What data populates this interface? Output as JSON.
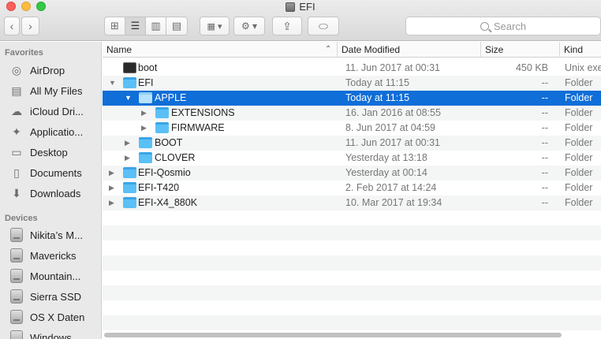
{
  "window": {
    "title": "EFI"
  },
  "toolbar": {
    "view_icons": [
      "icon-view-icon",
      "list-view-icon",
      "column-view-icon",
      "cover-flow-icon"
    ],
    "search_placeholder": "Search"
  },
  "sidebar": {
    "favorites_header": "Favorites",
    "favorites": [
      {
        "label": "AirDrop",
        "icon": "airdrop-icon"
      },
      {
        "label": "All My Files",
        "icon": "all-files-icon"
      },
      {
        "label": "iCloud Dri...",
        "icon": "icloud-icon"
      },
      {
        "label": "Applicatio...",
        "icon": "applications-icon"
      },
      {
        "label": "Desktop",
        "icon": "desktop-icon"
      },
      {
        "label": "Documents",
        "icon": "documents-icon"
      },
      {
        "label": "Downloads",
        "icon": "downloads-icon"
      }
    ],
    "devices_header": "Devices",
    "devices": [
      {
        "label": "Nikita’s M...",
        "icon": "computer-icon"
      },
      {
        "label": "Mavericks",
        "icon": "disk-icon"
      },
      {
        "label": "Mountain...",
        "icon": "disk-icon"
      },
      {
        "label": "Sierra SSD",
        "icon": "disk-icon"
      },
      {
        "label": "OS X Daten",
        "icon": "disk-icon"
      },
      {
        "label": "Windows",
        "icon": "disk-icon"
      }
    ]
  },
  "columns": {
    "name": "Name",
    "date": "Date Modified",
    "size": "Size",
    "kind": "Kind"
  },
  "files": [
    {
      "name": "boot",
      "date": "11. Jun 2017 at 00:31",
      "size": "450 KB",
      "kind": "Unix exe",
      "type": "exec",
      "level": 0,
      "expander": ""
    },
    {
      "name": "EFI",
      "date": "Today at 11:15",
      "size": "--",
      "kind": "Folder",
      "type": "folder",
      "level": 0,
      "expander": "▼"
    },
    {
      "name": "APPLE",
      "date": "Today at 11:15",
      "size": "--",
      "kind": "Folder",
      "type": "folder",
      "level": 1,
      "expander": "▼",
      "selected": true
    },
    {
      "name": "EXTENSIONS",
      "date": "16. Jan 2016 at 08:55",
      "size": "--",
      "kind": "Folder",
      "type": "folder",
      "level": 2,
      "expander": "▶"
    },
    {
      "name": "FIRMWARE",
      "date": "8. Jun 2017 at 04:59",
      "size": "--",
      "kind": "Folder",
      "type": "folder",
      "level": 2,
      "expander": "▶"
    },
    {
      "name": "BOOT",
      "date": "11. Jun 2017 at 00:31",
      "size": "--",
      "kind": "Folder",
      "type": "folder",
      "level": 1,
      "expander": "▶"
    },
    {
      "name": "CLOVER",
      "date": "Yesterday at 13:18",
      "size": "--",
      "kind": "Folder",
      "type": "folder",
      "level": 1,
      "expander": "▶"
    },
    {
      "name": "EFI-Qosmio",
      "date": "Yesterday at 00:14",
      "size": "--",
      "kind": "Folder",
      "type": "folder",
      "level": 0,
      "expander": "▶"
    },
    {
      "name": "EFI-T420",
      "date": "2. Feb 2017 at 14:24",
      "size": "--",
      "kind": "Folder",
      "type": "folder",
      "level": 0,
      "expander": "▶"
    },
    {
      "name": "EFI-X4_880K",
      "date": "10. Mar 2017 at 19:34",
      "size": "--",
      "kind": "Folder",
      "type": "folder",
      "level": 0,
      "expander": "▶"
    }
  ]
}
